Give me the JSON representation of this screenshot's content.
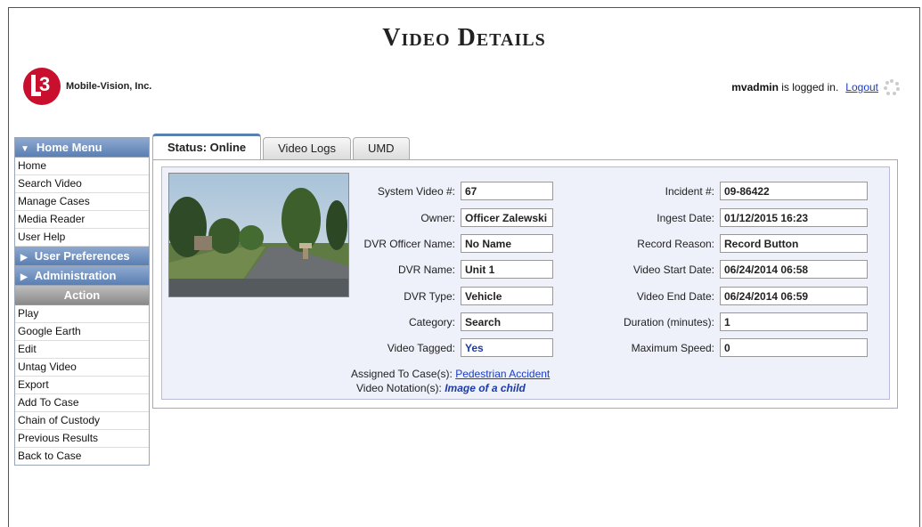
{
  "header": {
    "title": "Video Details",
    "logo_text": "Mobile-Vision, Inc.",
    "logo_mark": "L3",
    "username": "mvadmin",
    "login_suffix": "is logged in.",
    "logout_label": "Logout"
  },
  "sidebar": {
    "home_menu": {
      "label": "Home Menu",
      "items": [
        "Home",
        "Search Video",
        "Manage Cases",
        "Media Reader",
        "User Help"
      ]
    },
    "user_preferences_label": "User Preferences",
    "administration_label": "Administration",
    "action": {
      "label": "Action",
      "items": [
        "Play",
        "Google Earth",
        "Edit",
        "Untag Video",
        "Export",
        "Add To Case",
        "Chain of Custody",
        "Previous Results",
        "Back to Case"
      ]
    }
  },
  "tabs": [
    "Status: Online",
    "Video Logs",
    "UMD"
  ],
  "details": {
    "left": [
      {
        "label": "System Video #:",
        "value": "67"
      },
      {
        "label": "Owner:",
        "value": "Officer Zalewski"
      },
      {
        "label": "DVR Officer Name:",
        "value": "No Name"
      },
      {
        "label": "DVR Name:",
        "value": "Unit 1"
      },
      {
        "label": "DVR Type:",
        "value": "Vehicle"
      },
      {
        "label": "Category:",
        "value": "Search"
      },
      {
        "label": "Video Tagged:",
        "value": "Yes"
      }
    ],
    "right": [
      {
        "label": "Incident #:",
        "value": "09-86422"
      },
      {
        "label": "Ingest Date:",
        "value": "01/12/2015 16:23"
      },
      {
        "label": "Record Reason:",
        "value": "Record Button"
      },
      {
        "label": "Video Start Date:",
        "value": "06/24/2014 06:58"
      },
      {
        "label": "Video End Date:",
        "value": "06/24/2014 06:59"
      },
      {
        "label": "Duration (minutes):",
        "value": "1"
      },
      {
        "label": "Maximum Speed:",
        "value": "0"
      }
    ],
    "assigned_label": "Assigned To Case(s):",
    "assigned_value": "Pedestrian Accident",
    "notation_label": "Video Notation(s):",
    "notation_value": "Image of a child"
  },
  "colors": {
    "menu_header": "#5a7fb3",
    "panel_bg": "#eef0fa",
    "link": "#1a3cc8"
  }
}
